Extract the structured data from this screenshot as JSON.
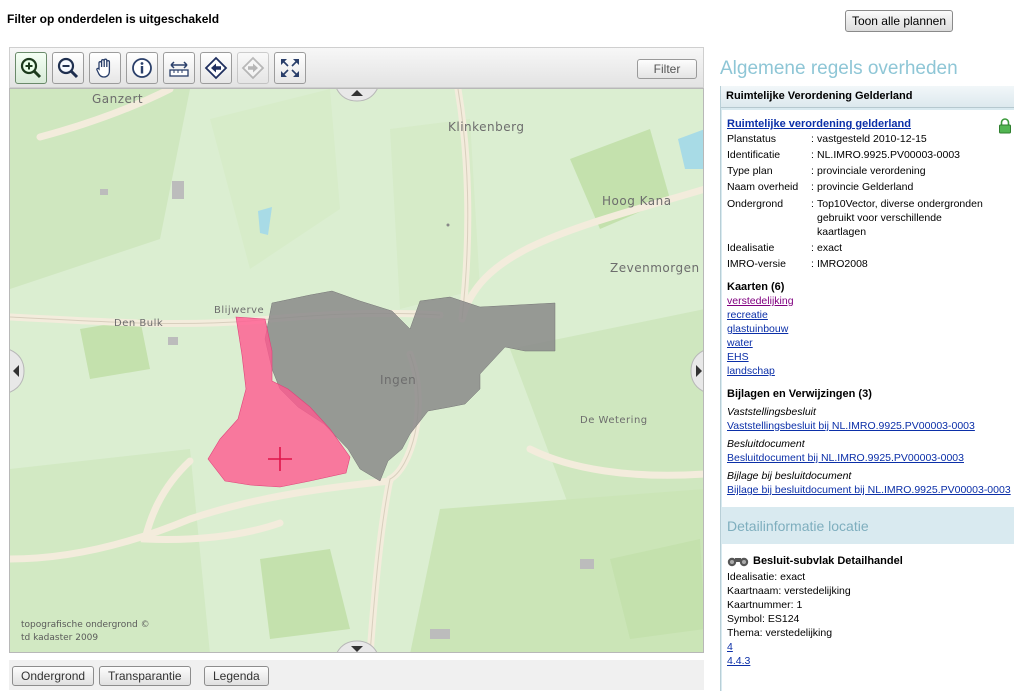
{
  "header": {
    "filter_status": "Filter op onderdelen is uitgeschakeld",
    "show_all_plans": "Toon alle plannen"
  },
  "toolbar": {
    "tools": [
      {
        "name": "zoom-in",
        "icon": "zoom-in-icon",
        "active": true
      },
      {
        "name": "zoom-out",
        "icon": "zoom-out-icon"
      },
      {
        "name": "pan",
        "icon": "hand-icon"
      },
      {
        "name": "info",
        "icon": "info-icon"
      },
      {
        "name": "measure",
        "icon": "measure-icon"
      },
      {
        "name": "back",
        "icon": "back-arrow-icon"
      },
      {
        "name": "forward",
        "icon": "forward-arrow-icon",
        "disabled": true
      },
      {
        "name": "full-extent",
        "icon": "full-extent-icon"
      }
    ],
    "filter_label": "Filter"
  },
  "map": {
    "places": {
      "ganzert": "Ganzert",
      "klinkenberg": "Klinkenberg",
      "hoog_kana": "Hoog Kana",
      "zevenmorgen": "Zevenmorgen",
      "blijwerve": "Blijwerve",
      "den_bulk": "Den Bulk",
      "ingen": "Ingen",
      "de_wetering": "De Wetering"
    },
    "copyright_line1": "topografische ondergrond ©",
    "copyright_line2": "td kadaster 2009",
    "colors": {
      "background": "#dbeed1",
      "field": "#cde7bd",
      "road": "#f2ead8",
      "urban": "#8a8a8a",
      "selected": "#ff5a90"
    }
  },
  "bottom": {
    "ondergrond": "Ondergrond",
    "transparantie": "Transparantie",
    "legenda": "Legenda"
  },
  "panel": {
    "title": "Algemene regels overheden",
    "plan_header": "Ruimtelijke Verordening Gelderland",
    "plan_name": "Ruimtelijke verordening gelderland",
    "props": {
      "planstatus_k": "Planstatus",
      "planstatus_v": "vastgesteld 2010-12-15",
      "identificatie_k": "Identificatie",
      "identificatie_v": "NL.IMRO.9925.PV00003-0003",
      "typeplan_k": "Type plan",
      "typeplan_v": "provinciale verordening",
      "naamoverheid_k": "Naam overheid",
      "naamoverheid_v": "provincie Gelderland",
      "ondergrond_k": "Ondergrond",
      "ondergrond_v1": "Top10Vector, diverse ondergronden",
      "ondergrond_v2": "gebruikt voor verschillende",
      "ondergrond_v3": "kaartlagen",
      "idealisatie_k": "Idealisatie",
      "idealisatie_v": "exact",
      "imro_k": "IMRO-versie",
      "imro_v": "IMRO2008",
      "colon": ":"
    },
    "kaarten_header": "Kaarten (6)",
    "kaarten": [
      "verstedelijking",
      "recreatie",
      "glastuinbouw",
      "water",
      "EHS",
      "landschap"
    ],
    "bijlagen_header": "Bijlagen en Verwijzingen (3)",
    "docs": [
      {
        "type": "Vaststellingsbesluit",
        "link": "Vaststellingsbesluit bij NL.IMRO.9925.PV00003-0003"
      },
      {
        "type": "Besluitdocument",
        "link": "Besluitdocument bij NL.IMRO.9925.PV00003-0003"
      },
      {
        "type": "Bijlage bij besluitdocument",
        "link": "Bijlage bij besluitdocument bij NL.IMRO.9925.PV00003-0003"
      }
    ],
    "detail_title": "Detailinformatie locatie",
    "detail": {
      "heading": "Besluit-subvlak Detailhandel",
      "idealisatie": "Idealisatie: exact",
      "kaartnaam": "Kaartnaam: verstedelijking",
      "kaartnummer": "Kaartnummer: 1",
      "symbol": "Symbol: ES124",
      "thema": "Thema: verstedelijking",
      "link1": "4",
      "link2": "4.4.3"
    },
    "accent_color": "#8ec6d6"
  }
}
